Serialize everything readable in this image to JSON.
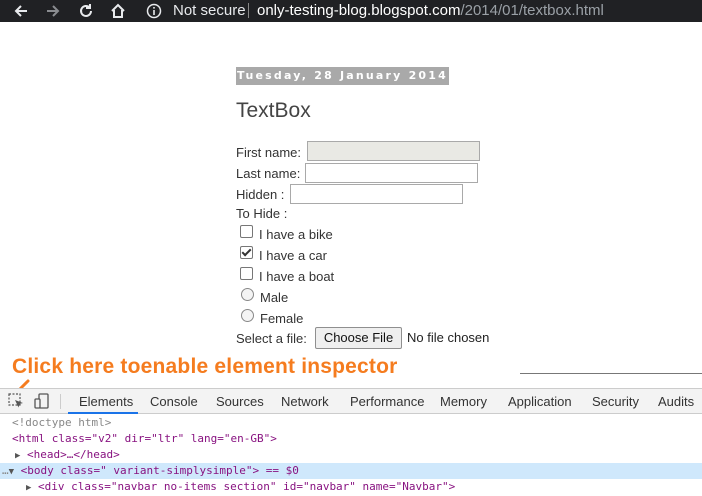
{
  "browser": {
    "back_icon": "arrow-left-icon",
    "forward_icon": "arrow-right-icon",
    "reload_icon": "reload-icon",
    "home_icon": "home-icon",
    "security_label": "Not secure",
    "url_host": "only-testing-blog.blogspot.com",
    "url_path": "/2014/01/textbox.html"
  },
  "page": {
    "date_header": "Tuesday, 28 January 2014",
    "post_title": "TextBox",
    "form": {
      "first_name_label": "First name:",
      "last_name_label": "Last name:",
      "hidden_label": "Hidden :",
      "to_hide_label": "To Hide :",
      "checkboxes": [
        {
          "label": "I have a bike",
          "checked": false
        },
        {
          "label": "I have a car",
          "checked": true
        },
        {
          "label": "I have a boat",
          "checked": false
        }
      ],
      "radios": [
        {
          "label": "Male",
          "checked": false
        },
        {
          "label": "Female",
          "checked": false
        }
      ],
      "file_label": "Select a file:",
      "file_button": "Choose File",
      "file_status": "No file chosen"
    }
  },
  "annotation": {
    "text": "Click here toenable element inspector",
    "color": "#f57c1f"
  },
  "devtools": {
    "inspect_icon": "inspect-element-icon",
    "device_icon": "device-toolbar-icon",
    "tabs": [
      "Elements",
      "Console",
      "Sources",
      "Network",
      "Performance",
      "Memory",
      "Application",
      "Security",
      "Audits"
    ],
    "active_tab": "Elements",
    "dom": {
      "doctype": "<!doctype html>",
      "html_open": "<html class=\"v2\" dir=\"ltr\" lang=\"en-GB\">",
      "head": "<head>…</head>",
      "body_line": "<body class=\" variant-simplysimple\"> == $0",
      "div_line": "<div class=\"navbar no-items section\" id=\"navbar\" name=\"Navbar\">"
    }
  }
}
